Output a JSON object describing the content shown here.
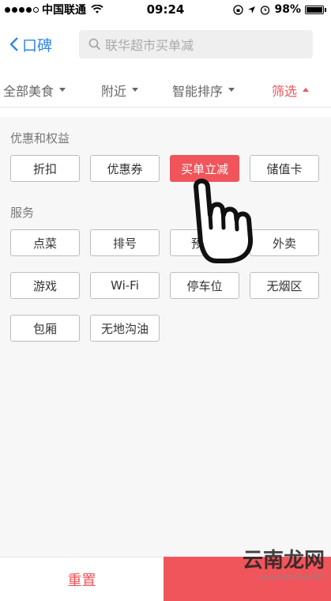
{
  "status_bar": {
    "carrier": "中国联通",
    "time": "09:24",
    "battery": "98%",
    "battery_level": 0.98
  },
  "nav": {
    "back_label": "口碑",
    "search_placeholder": "联华超市买单减"
  },
  "filters": [
    {
      "label": "全部美食"
    },
    {
      "label": "附近"
    },
    {
      "label": "智能排序"
    },
    {
      "label": "筛选",
      "active": true
    }
  ],
  "sections": {
    "benefits_title": "优惠和权益",
    "benefits": [
      "折扣",
      "优惠券",
      "买单立减",
      "储值卡"
    ],
    "selected_benefit": "买单立减",
    "services_title": "服务",
    "services": [
      "点菜",
      "排号",
      "预",
      "外卖",
      "游戏",
      "Wi-Fi",
      "停车位",
      "无烟区",
      "包厢",
      "无地沟油"
    ]
  },
  "footer": {
    "reset_label": "重置"
  },
  "watermark": {
    "main": "云南龙网",
    "sub": "www.xiazaiba.com"
  },
  "colors": {
    "accent": "#f0555b",
    "link": "#2f86e7"
  }
}
